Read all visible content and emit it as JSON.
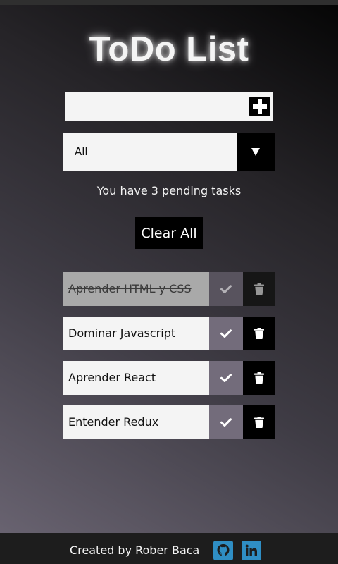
{
  "header": {
    "title": "ToDo List"
  },
  "add_form": {
    "input_value": "",
    "input_placeholder": "",
    "add_icon": "plus-icon"
  },
  "filter": {
    "selected": "All",
    "arrow_icon": "chevron-down-icon"
  },
  "status": {
    "pending_text": "You have 3 pending tasks"
  },
  "actions": {
    "clear_all_label": "Clear All"
  },
  "todos": [
    {
      "text": "Aprender HTML y CSS",
      "completed": true
    },
    {
      "text": "Dominar Javascript",
      "completed": false
    },
    {
      "text": "Aprender React",
      "completed": false
    },
    {
      "text": "Entender Redux",
      "completed": false
    }
  ],
  "todo_icons": {
    "check": "check-icon",
    "delete": "trash-icon"
  },
  "footer": {
    "credit": "Created by Rober Baca",
    "links": [
      {
        "icon": "github-icon"
      },
      {
        "icon": "linkedin-icon"
      }
    ]
  },
  "colors": {
    "accent": "#000000",
    "check_button": "#736c7b",
    "social_icon": "#2f8ec4",
    "footer_bg": "#1d1d1d"
  }
}
